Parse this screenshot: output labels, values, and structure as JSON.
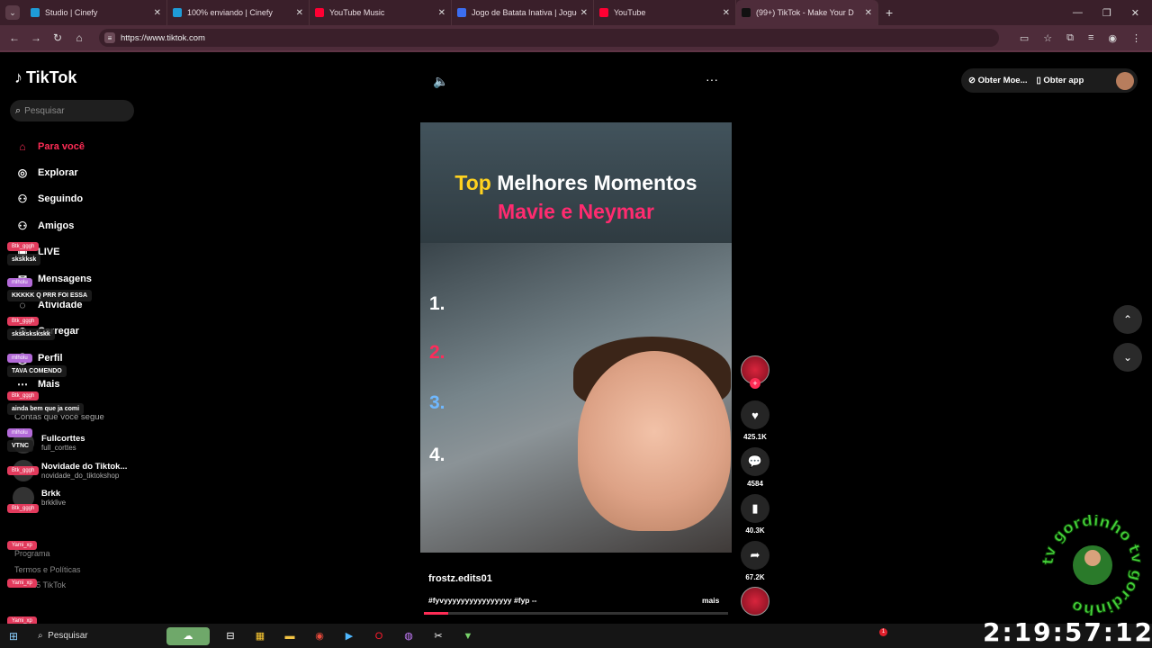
{
  "browser": {
    "tabs": [
      {
        "title": "Studio | Cinefy",
        "color": "#1e9bd7"
      },
      {
        "title": "100% enviando | Cinefy",
        "color": "#1e9bd7"
      },
      {
        "title": "YouTube Music",
        "color": "#ff0033"
      },
      {
        "title": "Jogo de Batata Inativa | Jogue",
        "color": "#3b6df0"
      },
      {
        "title": "YouTube",
        "color": "#ff0033"
      },
      {
        "title": "(99+) TikTok - Make Your D",
        "color": "#111111"
      }
    ],
    "url": "https://www.tiktok.com"
  },
  "sidebar": {
    "logo": "TikTok",
    "search_placeholder": "Pesquisar",
    "items": [
      {
        "label": "Para você",
        "icon": "home-icon"
      },
      {
        "label": "Explorar",
        "icon": "compass-icon"
      },
      {
        "label": "Seguindo",
        "icon": "following-icon"
      },
      {
        "label": "Amigos",
        "icon": "friends-icon"
      },
      {
        "label": "LIVE",
        "icon": "live-icon"
      },
      {
        "label": "Mensagens",
        "icon": "message-icon"
      },
      {
        "label": "Atividade",
        "icon": "activity-icon"
      },
      {
        "label": "Carregar",
        "icon": "upload-icon"
      },
      {
        "label": "Perfil",
        "icon": "profile-icon"
      },
      {
        "label": "Mais",
        "icon": "more-icon"
      }
    ],
    "following_title": "Contas que você segue",
    "accounts": [
      {
        "name": "Fullcorttes",
        "handle": "full_corttes"
      },
      {
        "name": "Novidade do Tiktok...",
        "handle": "novidade_do_tiktokshop"
      },
      {
        "name": "Brkk",
        "handle": "brkklive"
      }
    ],
    "footer": [
      "Programa",
      "Termos e Políticas",
      "© 2025 TikTok"
    ]
  },
  "chat_overlay": [
    {
      "user": "Btk_gggh",
      "msg": "skskksk"
    },
    {
      "user": "mlholu",
      "msg": "KKKKK Q PRR FOI ESSA"
    },
    {
      "user": "Btk_gggh",
      "msg": "skskskskskk"
    },
    {
      "user": "mlholu",
      "msg": "TAVA COMENDO"
    },
    {
      "user": "Btk_gggh",
      "msg": "ainda bem que ja comi"
    },
    {
      "user": "mlholu",
      "msg": "VTNC"
    },
    {
      "user": "Btk_gggh",
      "msg": ""
    },
    {
      "user": "Btk_gggh",
      "msg": ""
    },
    {
      "user": "Yami_xp",
      "msg": ""
    },
    {
      "user": "Yami_xp",
      "msg": ""
    },
    {
      "user": "Yami_xp",
      "msg": ""
    }
  ],
  "video": {
    "title_highlight": "Top",
    "title_rest": "Melhores Momentos",
    "subtitle": "Mavie e Neymar",
    "numbers": [
      "1.",
      "2.",
      "3.",
      "4."
    ],
    "author": "frostz.edits01",
    "caption": "#fyvyyyyyyyyyyyyyyyy #fyp --",
    "more_label": "mais",
    "progress": 0.08
  },
  "actions": {
    "likes": "425.1K",
    "comments": "4584",
    "saves": "40.3K",
    "shares": "67.2K"
  },
  "header_right": {
    "coins": "Obter Moe...",
    "app": "Obter app"
  },
  "watermark": {
    "text": "tv gordinho tv gordinho"
  },
  "taskbar": {
    "search": "Pesquisar",
    "notification_count": "1"
  },
  "clock": "2:19:57:12"
}
